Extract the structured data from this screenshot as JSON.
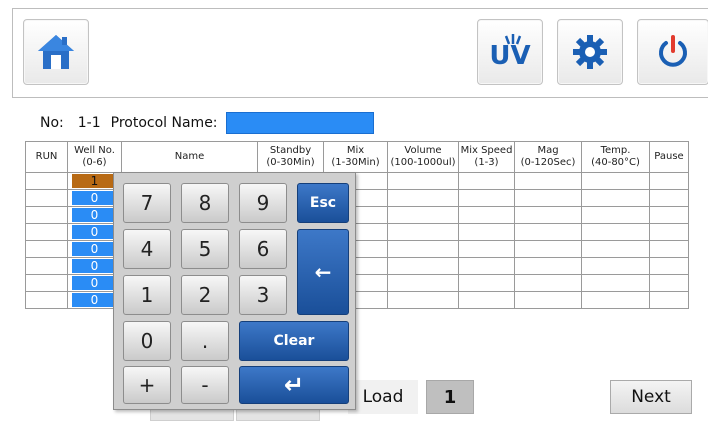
{
  "topbar": {
    "icons": [
      "home-icon",
      "uv-icon",
      "gear-icon",
      "power-icon"
    ],
    "uv_label": "UV",
    "colors": {
      "accent": "#1a5fb4"
    }
  },
  "protocol": {
    "no_label": "No:",
    "no_value": "1-1",
    "name_label": "Protocol Name:",
    "name_value": ""
  },
  "table": {
    "headers": [
      {
        "line1": "RUN",
        "line2": ""
      },
      {
        "line1": "Well No.",
        "line2": "(0-6)"
      },
      {
        "line1": "Name",
        "line2": ""
      },
      {
        "line1": "Standby",
        "line2": "(0-30Min)"
      },
      {
        "line1": "Mix",
        "line2": "(1-30Min)"
      },
      {
        "line1": "Volume",
        "line2": "(100-1000ul)"
      },
      {
        "line1": "Mix Speed",
        "line2": "(1-3)"
      },
      {
        "line1": "Mag",
        "line2": "(0-120Sec)"
      },
      {
        "line1": "Temp.",
        "line2": "(40-80°C)"
      },
      {
        "line1": "Pause",
        "line2": ""
      }
    ],
    "well_values": [
      "1",
      "0",
      "0",
      "0",
      "0",
      "0",
      "0",
      "0"
    ],
    "selected_row": 0
  },
  "keypad": {
    "k7": "7",
    "k8": "8",
    "k9": "9",
    "esc": "Esc",
    "k4": "4",
    "k5": "5",
    "k6": "6",
    "backspace": "←",
    "k1": "1",
    "k2": "2",
    "k3": "3",
    "k0": "0",
    "dot": ".",
    "clear": "Clear",
    "plus": "+",
    "minus": "-",
    "enter": "↵"
  },
  "bottom": {
    "load_label": "Load",
    "page_number": "1",
    "next_label": "Next"
  }
}
